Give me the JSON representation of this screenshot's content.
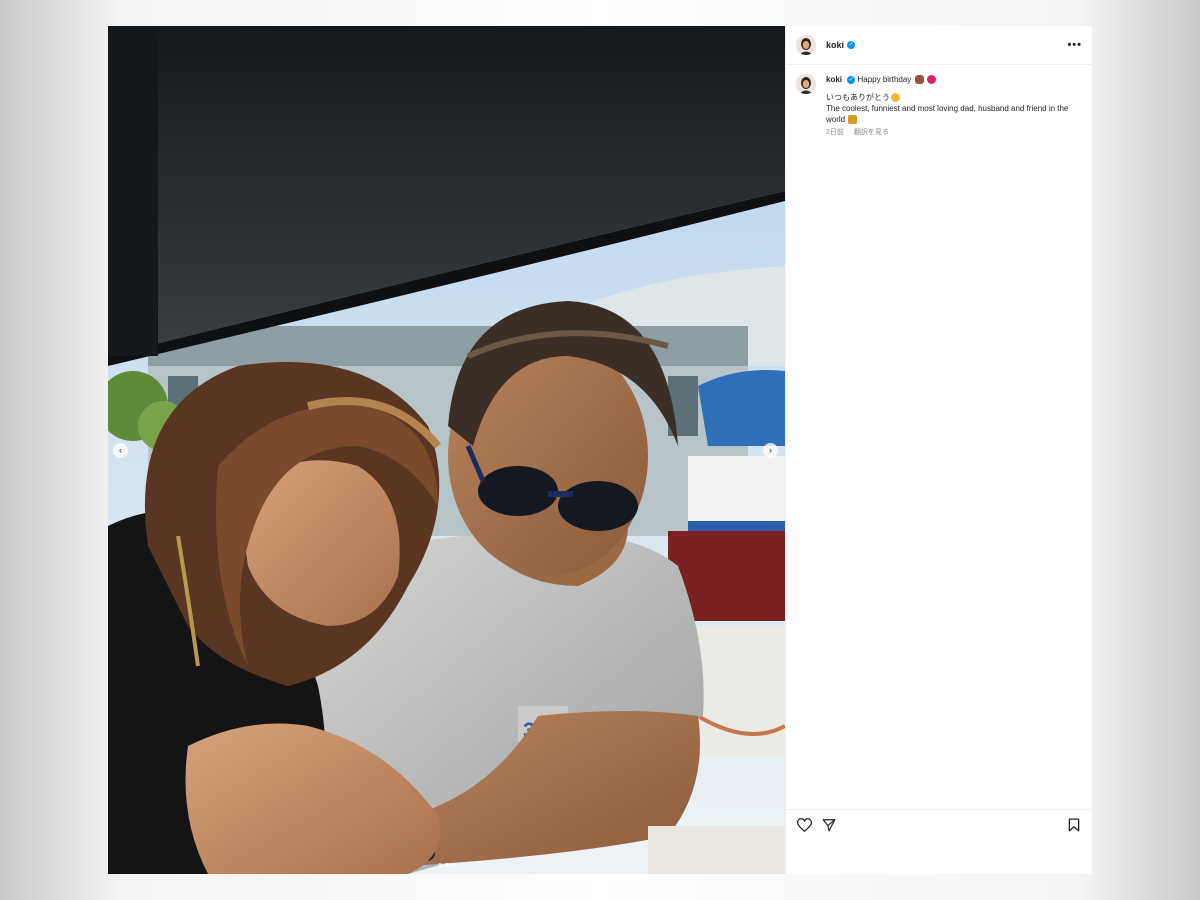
{
  "post": {
    "username": "koki",
    "verified_symbol": "✓",
    "more_symbol": "•••",
    "caption": {
      "username": "koki",
      "title_text": "Happy birthday",
      "line1": "いつもありがとう",
      "line2": "The coolest, funniest and most loving dad, husband and friend in the world",
      "emojis": [
        "bear-emoji",
        "heart-emoji",
        "smile-emoji",
        "sparkle-emoji"
      ]
    },
    "time_ago": "2日前",
    "translate_label": "翻訳を見る",
    "carousel": {
      "prev_symbol": "‹",
      "next_symbol": "›",
      "dot_count": 3,
      "active_dot": 2
    },
    "actions": [
      "heart-icon",
      "send-icon",
      "bookmark-icon"
    ]
  },
  "colors": {
    "verified": "#0095f6",
    "text": "#262626",
    "muted": "#8e8e8e"
  }
}
